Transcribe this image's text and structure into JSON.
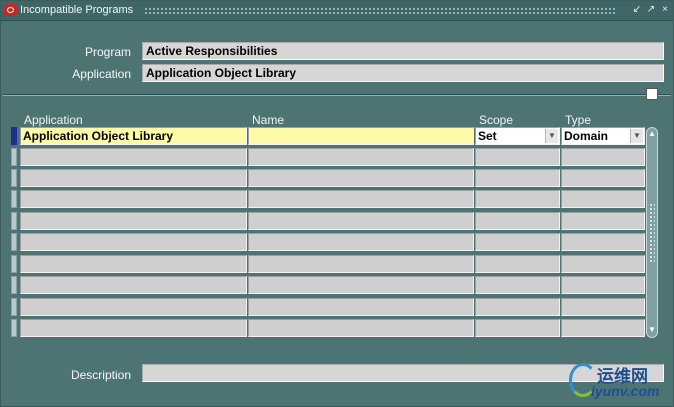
{
  "window": {
    "title": "Incompatible Programs",
    "controls": {
      "minimize": "↙",
      "maximize": "↗",
      "close": "×"
    }
  },
  "header": {
    "program_label": "Program",
    "program_value": "Active Responsibilities",
    "application_label": "Application",
    "application_value": "Application Object Library"
  },
  "table": {
    "columns": {
      "application": "Application",
      "name": "Name",
      "scope": "Scope",
      "type": "Type"
    },
    "rows": [
      {
        "application": "Application Object Library",
        "name": "",
        "scope": "Set",
        "type": "Domain"
      },
      {
        "application": "",
        "name": "",
        "scope": "",
        "type": ""
      },
      {
        "application": "",
        "name": "",
        "scope": "",
        "type": ""
      },
      {
        "application": "",
        "name": "",
        "scope": "",
        "type": ""
      },
      {
        "application": "",
        "name": "",
        "scope": "",
        "type": ""
      },
      {
        "application": "",
        "name": "",
        "scope": "",
        "type": ""
      },
      {
        "application": "",
        "name": "",
        "scope": "",
        "type": ""
      },
      {
        "application": "",
        "name": "",
        "scope": "",
        "type": ""
      },
      {
        "application": "",
        "name": "",
        "scope": "",
        "type": ""
      },
      {
        "application": "",
        "name": "",
        "scope": "",
        "type": ""
      }
    ]
  },
  "footer": {
    "description_label": "Description",
    "description_value": ""
  },
  "watermark": {
    "text": "运维网",
    "url": "iyunv.com"
  },
  "colors": {
    "canvas": "#4d7373",
    "current_record": "#fffaa8",
    "current_row_indicator": "#1e2e8f",
    "field": "#d6d6d6"
  },
  "icons": {
    "app": "oracle-logo-icon",
    "dropdown": "chevron-down-icon",
    "scroll_up": "triangle-up-icon",
    "scroll_down": "triangle-down-icon"
  }
}
